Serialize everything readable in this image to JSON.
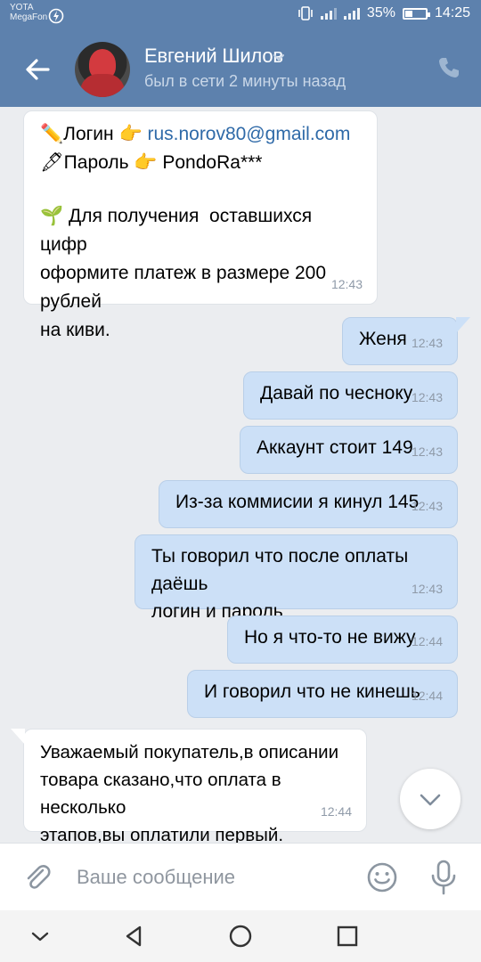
{
  "status_bar": {
    "carrier_1": "YOTA",
    "carrier_2": "MegaFon",
    "battery": "35%",
    "time": "14:25"
  },
  "header": {
    "contact_name": "Евгений Шилов",
    "last_seen": "был в сети 2 минуты назад",
    "back_icon": "arrow-left-icon",
    "call_icon": "phone-icon"
  },
  "messages": [
    {
      "direction": "incoming",
      "lines": [
        {
          "emoji": "✏️",
          "text": "Логин ",
          "pointer": "👉",
          "value": "rus.norov80@gmail.com"
        },
        {
          "emoji": "🖋",
          "text": "Пароль ",
          "pointer": "👉",
          "value": "PondoRa***"
        }
      ],
      "body": "Для получения  оставшихся цифр\nоформите платеж в размере 200 рублей\nна киви.",
      "body_emoji": "🌱",
      "time": "12:43"
    },
    {
      "direction": "outgoing",
      "text": "Женя",
      "time": "12:43"
    },
    {
      "direction": "outgoing",
      "text": "Давай по чесноку",
      "time": "12:43"
    },
    {
      "direction": "outgoing",
      "text": "Аккаунт стоит 149",
      "time": "12:43"
    },
    {
      "direction": "outgoing",
      "text": "Из-за коммисии я кинул 145",
      "time": "12:43"
    },
    {
      "direction": "outgoing",
      "text": "Ты говорил что после оплаты даёшь\nлогин и пароль",
      "time": "12:43"
    },
    {
      "direction": "outgoing",
      "text": "Но я что-то не вижу",
      "time": "12:44"
    },
    {
      "direction": "outgoing",
      "text": "И говорил что не кинешь",
      "time": "12:44"
    },
    {
      "direction": "incoming",
      "text": "Уважаемый покупатель,в описании\nтовара сказано,что оплата в несколько\nэтапов,вы оплатили первый.",
      "time": "12:44"
    }
  ],
  "composer": {
    "placeholder": "Ваше сообщение"
  },
  "colors": {
    "header": "#5d81ad",
    "chat_bg": "#ebedf0",
    "bubble_out": "#cce0f7",
    "bubble_in": "#ffffff",
    "link": "#2f6aa8"
  }
}
